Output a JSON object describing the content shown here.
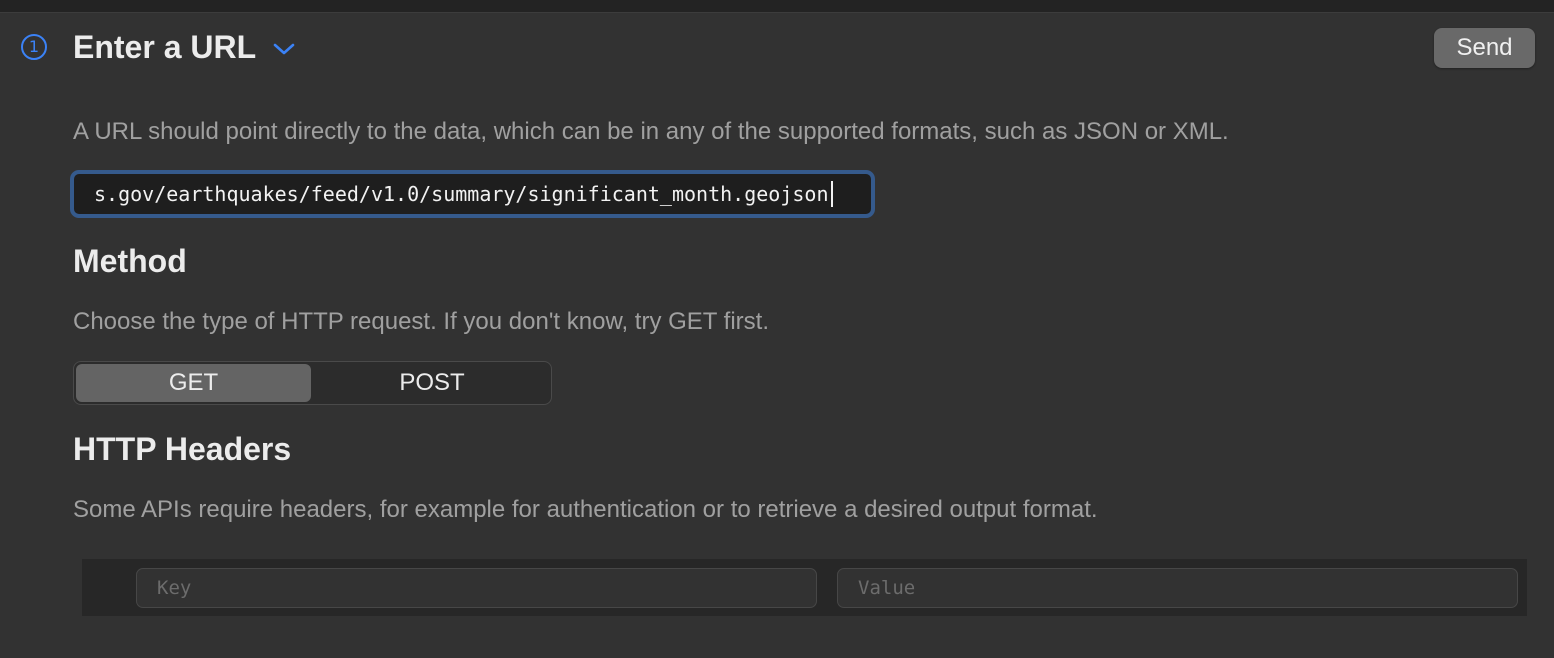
{
  "step": {
    "number": "1",
    "title": "Enter a URL",
    "send_label": "Send"
  },
  "url_section": {
    "description": "A URL should point directly to the data, which can be in any of the supported formats, such as JSON or XML.",
    "url_value": "s.gov/earthquakes/feed/v1.0/summary/significant_month.geojson"
  },
  "method_section": {
    "heading": "Method",
    "description": "Choose the type of HTTP request. If you don't know, try GET first.",
    "options": [
      "GET",
      "POST"
    ],
    "selected": "GET"
  },
  "headers_section": {
    "heading": "HTTP Headers",
    "description": "Some APIs require headers, for example for authentication or to retrieve a desired output format.",
    "key_placeholder": "Key",
    "value_placeholder": "Value"
  },
  "colors": {
    "background": "#323232",
    "accent": "#3b82f6",
    "focus_ring": "#355a8c",
    "selected_segment": "#646464"
  },
  "icons": {
    "disclosure": "chevron-down-icon"
  }
}
